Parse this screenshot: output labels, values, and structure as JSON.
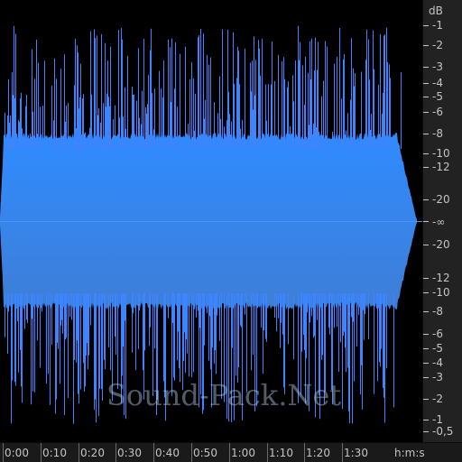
{
  "colors": {
    "background": "#000000",
    "panel": "#1a1a1a",
    "ruler": "#222222",
    "separator": "#0a0a0a",
    "grid": "#3d3d3d",
    "text": "#c4c4c4",
    "wave_top": "#2f8bff",
    "wave_bottom": "#3f7ed6",
    "peaks": "#3c85ff"
  },
  "watermark": "Sound-Pack.Net",
  "db_scale": {
    "unit": "dB",
    "top_labels": [
      "-1",
      "-2",
      "-3",
      "-4",
      "-5",
      "-6",
      "-8",
      "-10",
      "-12",
      "-20"
    ],
    "center_label": "-∞",
    "bottom_labels": [
      "-20",
      "-12",
      "-10",
      "-8",
      "-6",
      "-5",
      "-4",
      "-3",
      "-2",
      "-1",
      "-0,5"
    ]
  },
  "time_ruler": {
    "labels": [
      "0:00",
      "0:10",
      "0:20",
      "0:30",
      "0:40",
      "0:50",
      "1:00",
      "1:10",
      "1:20",
      "1:30"
    ],
    "format": "h:m:s"
  }
}
